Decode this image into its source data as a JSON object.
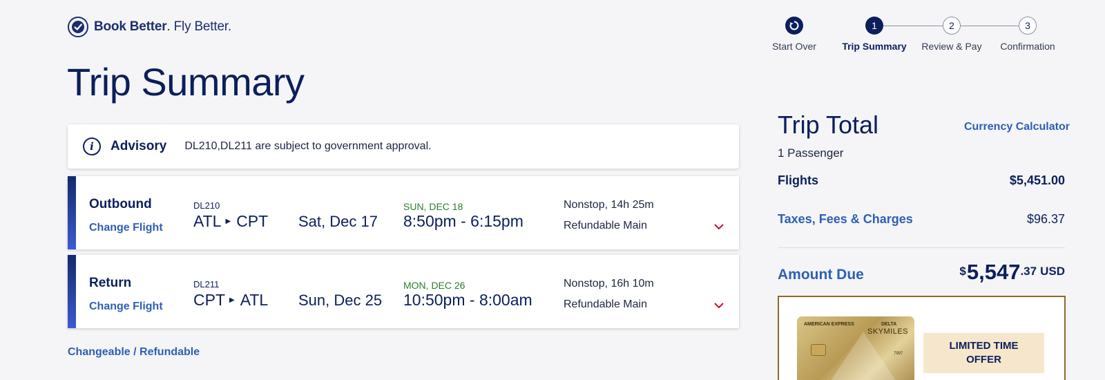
{
  "logo": {
    "bold": "Book Better",
    "rest": ". Fly Better."
  },
  "stepper": {
    "start_over": "Start Over",
    "steps": [
      {
        "num": "1",
        "label": "Trip Summary",
        "active": true
      },
      {
        "num": "2",
        "label": "Review & Pay",
        "active": false
      },
      {
        "num": "3",
        "label": "Confirmation",
        "active": false
      }
    ]
  },
  "page_title": "Trip Summary",
  "advisory": {
    "title": "Advisory",
    "text": "DL210,DL211 are subject to government approval."
  },
  "flights": [
    {
      "direction": "Outbound",
      "change_label": "Change Flight",
      "flight_number": "DL210",
      "origin": "ATL",
      "destination": "CPT",
      "date": "Sat, Dec 17",
      "arrival_day": "SUN, DEC 18",
      "times": "8:50pm - 6:15pm",
      "stops": "Nonstop, 14h 25m",
      "fare": "Refundable Main"
    },
    {
      "direction": "Return",
      "change_label": "Change Flight",
      "flight_number": "DL211",
      "origin": "CPT",
      "destination": "ATL",
      "date": "Sun, Dec 25",
      "arrival_day": "MON, DEC 26",
      "times": "10:50pm - 8:00am",
      "stops": "Nonstop, 16h 10m",
      "fare": "Refundable Main"
    }
  ],
  "changeable_link": "Changeable / Refundable",
  "trip_total": {
    "title": "Trip Total",
    "currency_calculator": "Currency Calculator",
    "passengers": "1 Passenger",
    "flights_label": "Flights",
    "flights_value": "$5,451.00",
    "taxes_label": "Taxes, Fees & Charges",
    "taxes_value": "$96.37",
    "amount_due_label": "Amount Due",
    "amount_due": {
      "currency_symbol": "$",
      "whole": "5,547",
      "cents": ".37",
      "code": "USD"
    }
  },
  "promo": {
    "card_brand_left": "AMERICAN EXPRESS",
    "card_brand_right": "DELTA",
    "card_program": "SKYMILES",
    "card_digits": "7997",
    "offer_text": "LIMITED TIME OFFER"
  },
  "colors": {
    "navy": "#0b1f5c",
    "link_blue": "#2d5fb5",
    "green": "#2a7d2e",
    "chevron_red": "#c8102e",
    "promo_gold": "#8a6a2b"
  }
}
